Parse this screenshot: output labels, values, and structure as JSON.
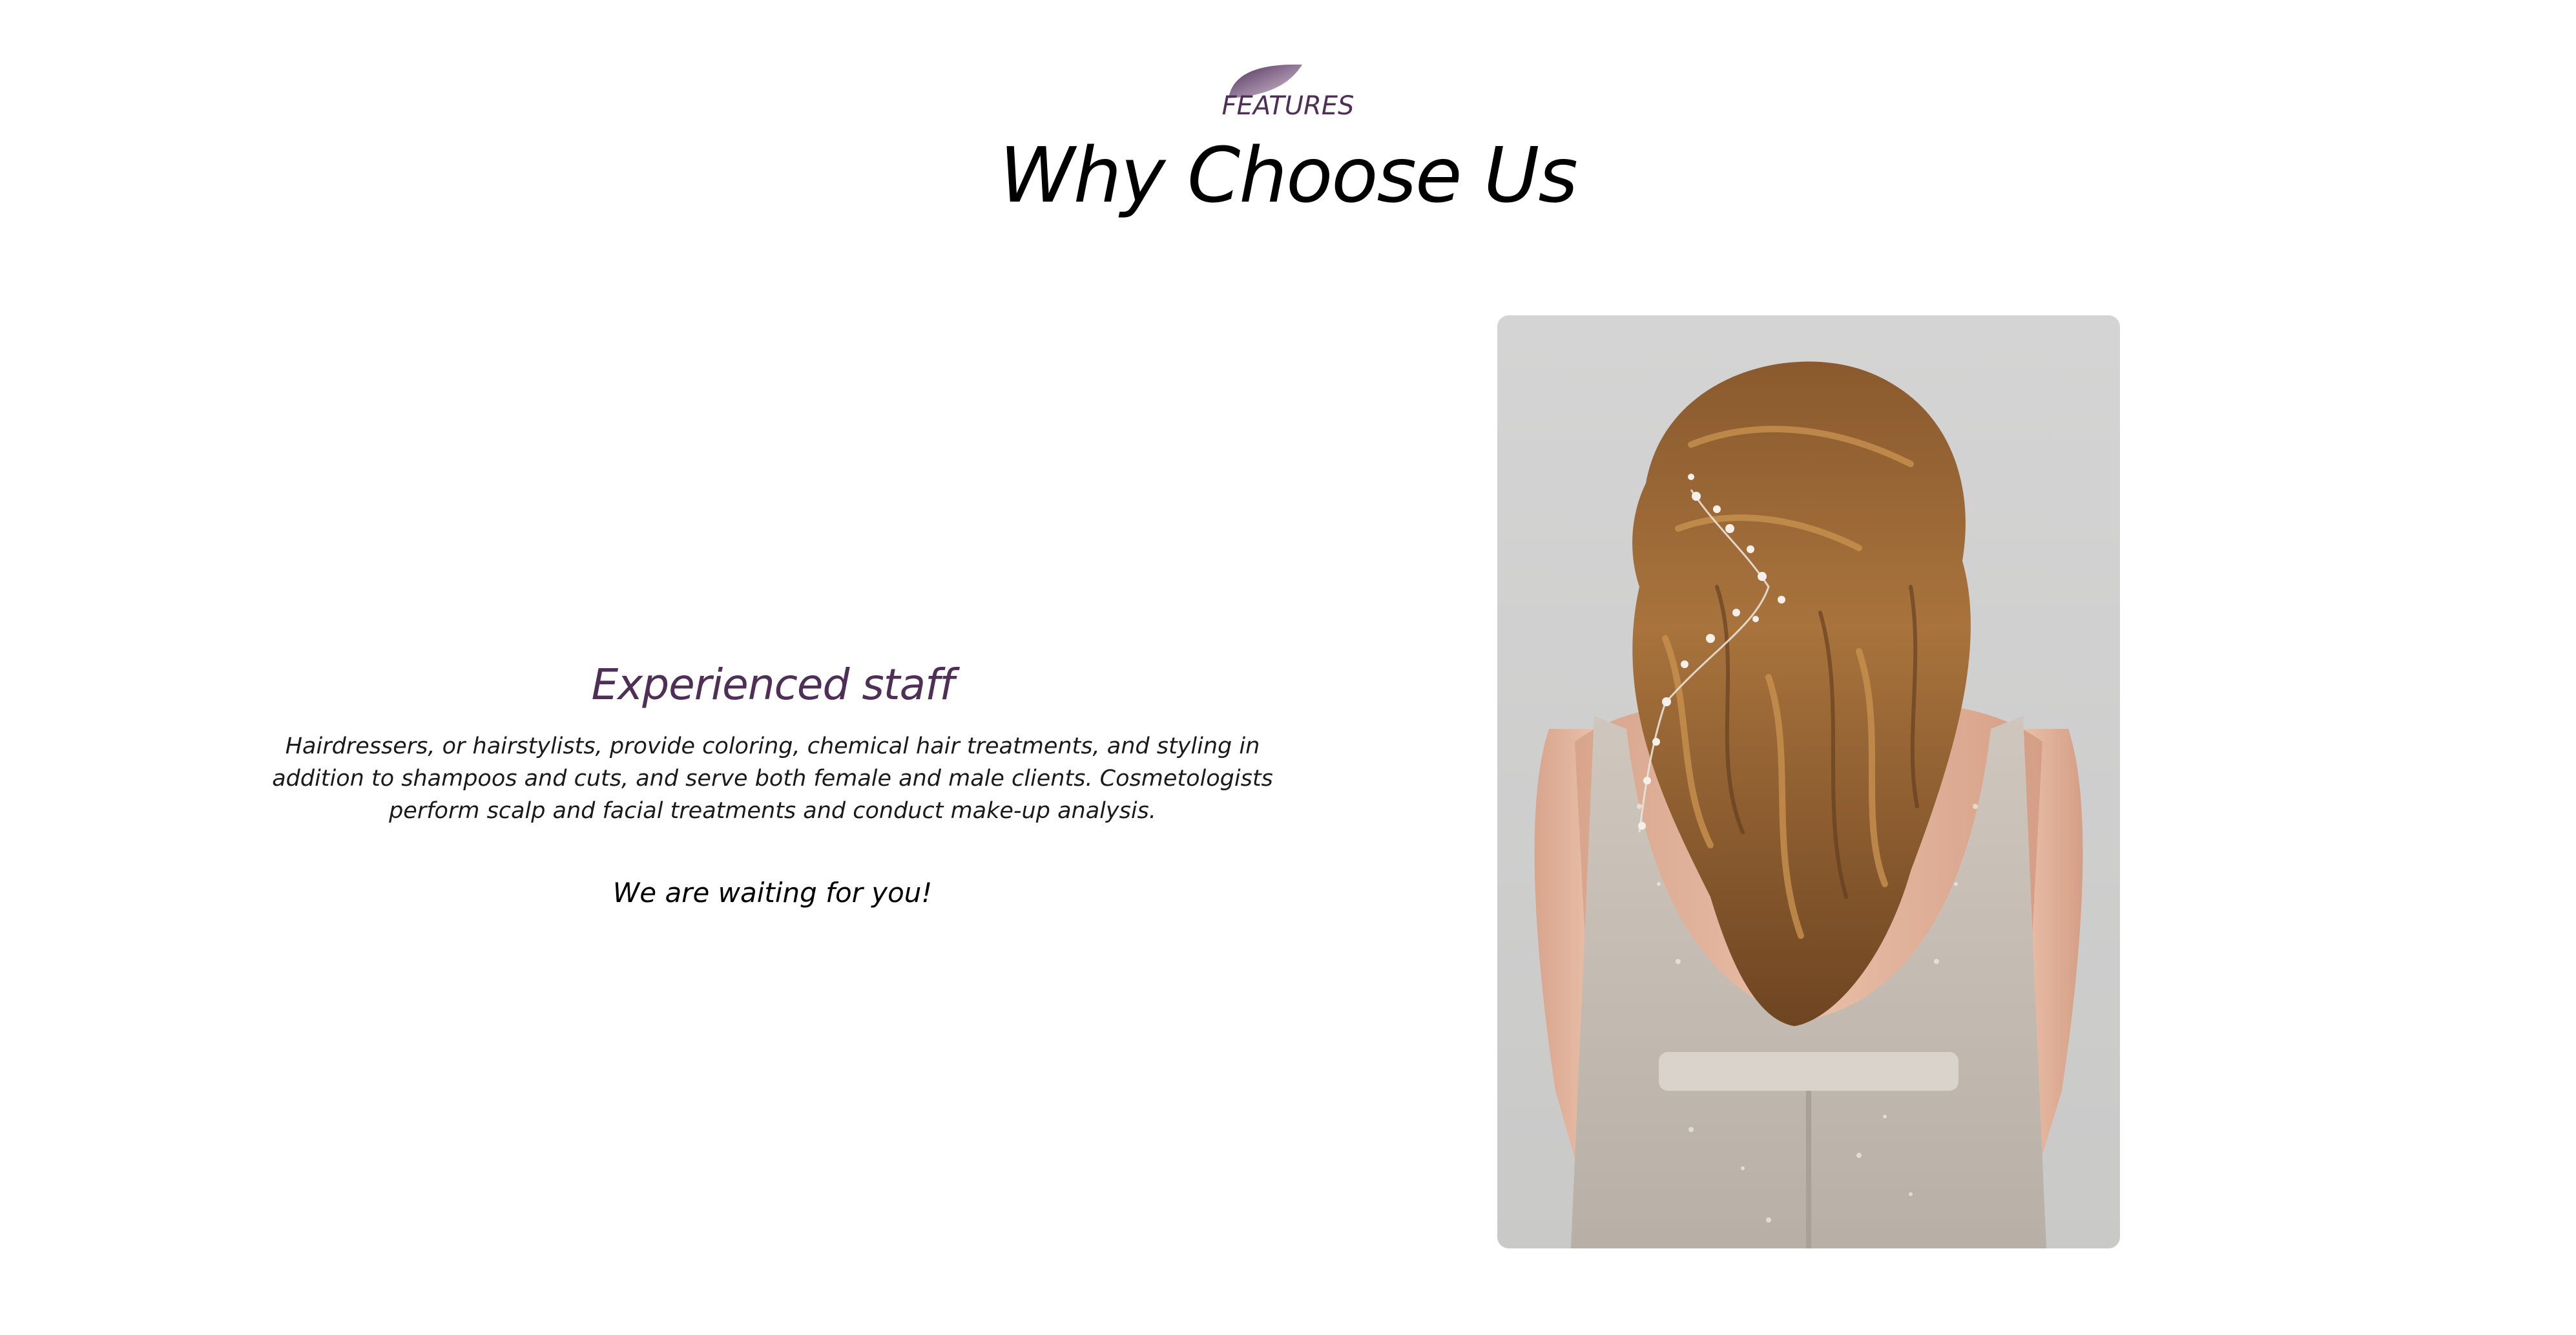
{
  "header": {
    "eyebrow": "FEATURES",
    "title": "Why Choose Us"
  },
  "feature": {
    "title": "Experienced staff",
    "description": "Hairdressers, or hairstylists, provide coloring, chemical hair treatments, and styling in addition to shampoos and cuts, and serve both female and male clients. Cosmetologists perform scalp and facial treatments and conduct make-up analysis.",
    "cta": "We are waiting for you!"
  },
  "photo": {
    "subject": "bride-back-view-wavy-hair-with-hair-vine"
  },
  "colors": {
    "accent": "#4f2f57",
    "title": "#000000",
    "background": "#ffffff",
    "photo_backdrop": "#cfcfcf"
  }
}
